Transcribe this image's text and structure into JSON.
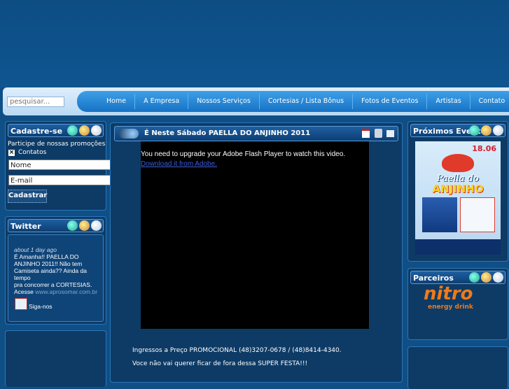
{
  "search": {
    "placeholder": "pesquisar..."
  },
  "nav": {
    "items": [
      "Home",
      "A Empresa",
      "Nossos Serviços",
      "Cortesias / Lista Bônus",
      "Fotos de Eventos",
      "Artistas",
      "Contato"
    ]
  },
  "cadastre": {
    "title": "Cadastre-se",
    "intro": "Participe de nossas promoções",
    "checkbox_label": "Contatos",
    "name_value": "Nome",
    "email_value": "E-mail",
    "submit_label": "Cadastrar"
  },
  "twitter": {
    "title": "Twitter",
    "time": "about 1 day ago",
    "text_lines": [
      "É Amanha!! PAELLA DO",
      "ANJINHO 2011!! Não tem",
      "Camiseta ainda?? Ainda da tempo",
      "pra concorrer a CORTESIAS."
    ],
    "acesse": "Acesse",
    "link": "www.aprosomar.com.br",
    "follow": "Siga-nos"
  },
  "article": {
    "title": "É Neste Sábado PAELLA DO ANJINHO 2011",
    "flash_message": "You need to upgrade your Adobe Flash Player to watch this video.",
    "flash_link": "Download it from Adobe.",
    "line1": "Ingressos a Preço PROMOCIONAL (48)3207-0678 / (48)8414-4340.",
    "line2": "Voce não vai querer ficar de fora dessa SUPER FESTA!!!"
  },
  "events": {
    "title": "Próximos Eventos",
    "poster_date": "18.06",
    "poster_title_1": "Paella do",
    "poster_title_2": "ANJINHO"
  },
  "partners": {
    "title": "Parceiros",
    "brand": "nitro",
    "brand_sub": "energy drink"
  },
  "colors": {
    "background": "#0f4f86",
    "nav_blue": "#1e82d4",
    "panel": "#0d3b66",
    "brand_orange": "#f07a1a"
  }
}
